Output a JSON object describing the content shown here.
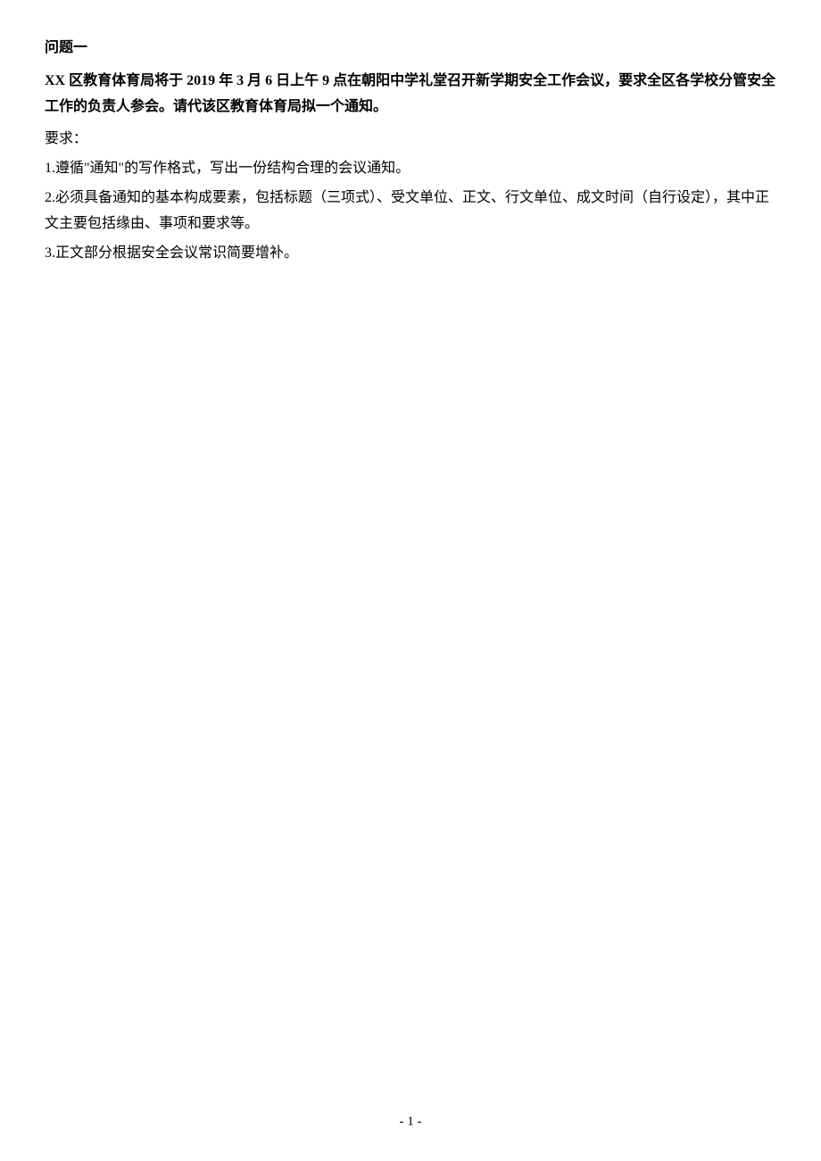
{
  "document": {
    "question_label": "问题一",
    "prompt": "XX 区教育体育局将于 2019 年 3 月 6 日上午 9 点在朝阳中学礼堂召开新学期安全工作会议，要求全区各学校分管安全工作的负责人参会。请代该区教育体育局拟一个通知。",
    "requirements_label": "要求：",
    "requirements": [
      "1.遵循\"通知\"的写作格式，写出一份结构合理的会议通知。",
      "2.必须具备通知的基本构成要素，包括标题（三项式）、受文单位、正文、行文单位、成文时间（自行设定），其中正文主要包括缘由、事项和要求等。",
      "3.正文部分根据安全会议常识简要增补。"
    ],
    "page_number": "- 1 -"
  }
}
